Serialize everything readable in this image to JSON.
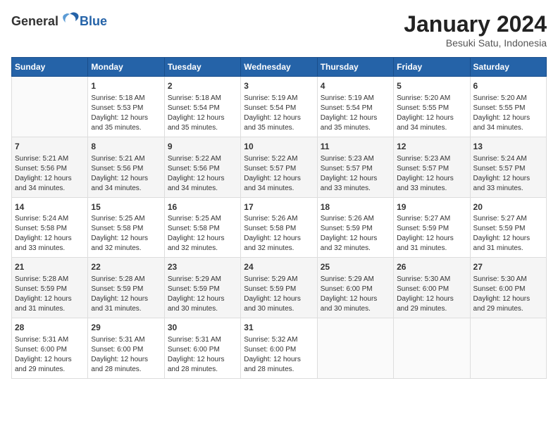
{
  "header": {
    "logo_general": "General",
    "logo_blue": "Blue",
    "title": "January 2024",
    "location": "Besuki Satu, Indonesia"
  },
  "days_of_week": [
    "Sunday",
    "Monday",
    "Tuesday",
    "Wednesday",
    "Thursday",
    "Friday",
    "Saturday"
  ],
  "weeks": [
    [
      {
        "day": "",
        "info": ""
      },
      {
        "day": "1",
        "info": "Sunrise: 5:18 AM\nSunset: 5:53 PM\nDaylight: 12 hours\nand 35 minutes."
      },
      {
        "day": "2",
        "info": "Sunrise: 5:18 AM\nSunset: 5:54 PM\nDaylight: 12 hours\nand 35 minutes."
      },
      {
        "day": "3",
        "info": "Sunrise: 5:19 AM\nSunset: 5:54 PM\nDaylight: 12 hours\nand 35 minutes."
      },
      {
        "day": "4",
        "info": "Sunrise: 5:19 AM\nSunset: 5:54 PM\nDaylight: 12 hours\nand 35 minutes."
      },
      {
        "day": "5",
        "info": "Sunrise: 5:20 AM\nSunset: 5:55 PM\nDaylight: 12 hours\nand 34 minutes."
      },
      {
        "day": "6",
        "info": "Sunrise: 5:20 AM\nSunset: 5:55 PM\nDaylight: 12 hours\nand 34 minutes."
      }
    ],
    [
      {
        "day": "7",
        "info": "Sunrise: 5:21 AM\nSunset: 5:56 PM\nDaylight: 12 hours\nand 34 minutes."
      },
      {
        "day": "8",
        "info": "Sunrise: 5:21 AM\nSunset: 5:56 PM\nDaylight: 12 hours\nand 34 minutes."
      },
      {
        "day": "9",
        "info": "Sunrise: 5:22 AM\nSunset: 5:56 PM\nDaylight: 12 hours\nand 34 minutes."
      },
      {
        "day": "10",
        "info": "Sunrise: 5:22 AM\nSunset: 5:57 PM\nDaylight: 12 hours\nand 34 minutes."
      },
      {
        "day": "11",
        "info": "Sunrise: 5:23 AM\nSunset: 5:57 PM\nDaylight: 12 hours\nand 33 minutes."
      },
      {
        "day": "12",
        "info": "Sunrise: 5:23 AM\nSunset: 5:57 PM\nDaylight: 12 hours\nand 33 minutes."
      },
      {
        "day": "13",
        "info": "Sunrise: 5:24 AM\nSunset: 5:57 PM\nDaylight: 12 hours\nand 33 minutes."
      }
    ],
    [
      {
        "day": "14",
        "info": "Sunrise: 5:24 AM\nSunset: 5:58 PM\nDaylight: 12 hours\nand 33 minutes."
      },
      {
        "day": "15",
        "info": "Sunrise: 5:25 AM\nSunset: 5:58 PM\nDaylight: 12 hours\nand 32 minutes."
      },
      {
        "day": "16",
        "info": "Sunrise: 5:25 AM\nSunset: 5:58 PM\nDaylight: 12 hours\nand 32 minutes."
      },
      {
        "day": "17",
        "info": "Sunrise: 5:26 AM\nSunset: 5:58 PM\nDaylight: 12 hours\nand 32 minutes."
      },
      {
        "day": "18",
        "info": "Sunrise: 5:26 AM\nSunset: 5:59 PM\nDaylight: 12 hours\nand 32 minutes."
      },
      {
        "day": "19",
        "info": "Sunrise: 5:27 AM\nSunset: 5:59 PM\nDaylight: 12 hours\nand 31 minutes."
      },
      {
        "day": "20",
        "info": "Sunrise: 5:27 AM\nSunset: 5:59 PM\nDaylight: 12 hours\nand 31 minutes."
      }
    ],
    [
      {
        "day": "21",
        "info": "Sunrise: 5:28 AM\nSunset: 5:59 PM\nDaylight: 12 hours\nand 31 minutes."
      },
      {
        "day": "22",
        "info": "Sunrise: 5:28 AM\nSunset: 5:59 PM\nDaylight: 12 hours\nand 31 minutes."
      },
      {
        "day": "23",
        "info": "Sunrise: 5:29 AM\nSunset: 5:59 PM\nDaylight: 12 hours\nand 30 minutes."
      },
      {
        "day": "24",
        "info": "Sunrise: 5:29 AM\nSunset: 5:59 PM\nDaylight: 12 hours\nand 30 minutes."
      },
      {
        "day": "25",
        "info": "Sunrise: 5:29 AM\nSunset: 6:00 PM\nDaylight: 12 hours\nand 30 minutes."
      },
      {
        "day": "26",
        "info": "Sunrise: 5:30 AM\nSunset: 6:00 PM\nDaylight: 12 hours\nand 29 minutes."
      },
      {
        "day": "27",
        "info": "Sunrise: 5:30 AM\nSunset: 6:00 PM\nDaylight: 12 hours\nand 29 minutes."
      }
    ],
    [
      {
        "day": "28",
        "info": "Sunrise: 5:31 AM\nSunset: 6:00 PM\nDaylight: 12 hours\nand 29 minutes."
      },
      {
        "day": "29",
        "info": "Sunrise: 5:31 AM\nSunset: 6:00 PM\nDaylight: 12 hours\nand 28 minutes."
      },
      {
        "day": "30",
        "info": "Sunrise: 5:31 AM\nSunset: 6:00 PM\nDaylight: 12 hours\nand 28 minutes."
      },
      {
        "day": "31",
        "info": "Sunrise: 5:32 AM\nSunset: 6:00 PM\nDaylight: 12 hours\nand 28 minutes."
      },
      {
        "day": "",
        "info": ""
      },
      {
        "day": "",
        "info": ""
      },
      {
        "day": "",
        "info": ""
      }
    ]
  ]
}
